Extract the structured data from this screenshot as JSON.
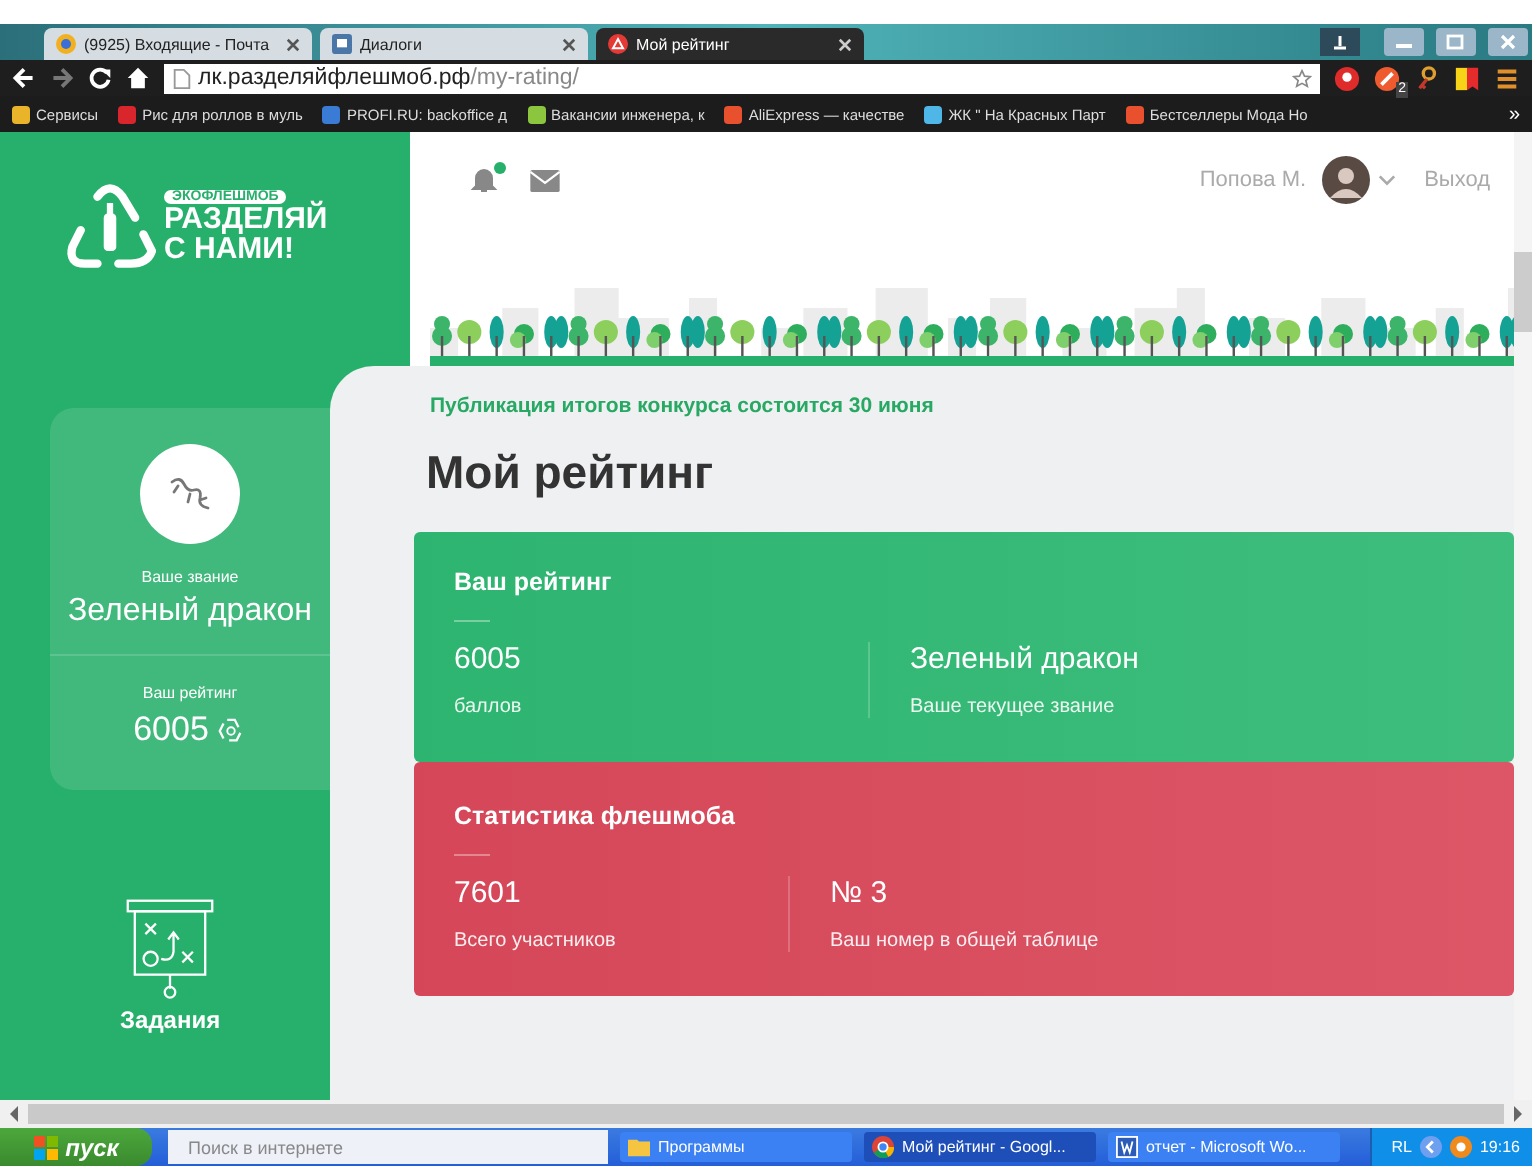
{
  "browser": {
    "tabs": [
      {
        "title": "(9925) Входящие - Почта",
        "kind": "mail",
        "selected": false
      },
      {
        "title": "Диалоги",
        "kind": "chat",
        "selected": false
      },
      {
        "title": "Мой рейтинг",
        "kind": "warn",
        "selected": true
      }
    ],
    "url": {
      "host": "лк.разделяйфлешмоб.рф",
      "path": "/my-rating/"
    },
    "extension_badge": "2",
    "bookmarks": [
      {
        "label": "Сервисы",
        "color": "#e9b42a"
      },
      {
        "label": "Рис для роллов в муль",
        "color": "#d8262c"
      },
      {
        "label": "PROFI.RU: backoffice д",
        "color": "#3a7bd5"
      },
      {
        "label": "Вакансии инженера, к",
        "color": "#8cc63f"
      },
      {
        "label": "AliExpress — качестве",
        "color": "#e8502e"
      },
      {
        "label": "ЖК \" На Красных Парт",
        "color": "#4fb6e8"
      },
      {
        "label": "Бестселлеры Мода Но",
        "color": "#e8502e"
      }
    ],
    "bookmarks_more": "»"
  },
  "sidebar": {
    "logo": {
      "tag": "ЭКОФЛЕШМОБ",
      "line1": "РАЗДЕЛЯЙ",
      "line2": "С НАМИ!"
    },
    "rank_label": "Ваше звание",
    "rank": "Зеленый дракон",
    "rating_label": "Ваш рейтинг",
    "rating": "6005",
    "nav": [
      {
        "label": "Задания"
      }
    ]
  },
  "header": {
    "notifications_unread": true,
    "user": "Попова М.",
    "logout": "Выход"
  },
  "notice": "Публикация итогов конкурса состоится 30 июня",
  "title": "Мой рейтинг",
  "cards": [
    {
      "kind": "rating",
      "color": "#2eb872",
      "title": "Ваш рейтинг",
      "stats": [
        {
          "value": "6005",
          "label": "баллов"
        },
        {
          "value": "Зеленый дракон",
          "label": "Ваше текущее звание"
        }
      ]
    },
    {
      "kind": "stats",
      "color": "#d9485a",
      "title": "Статистика флешмоба",
      "stats": [
        {
          "value": "7601",
          "label": "Всего участников"
        },
        {
          "value": "№ 3",
          "label": "Ваш номер в общей таблице"
        }
      ]
    }
  ],
  "taskbar": {
    "start": "пуск",
    "search_placeholder": "Поиск в интернете",
    "tasks": [
      {
        "label": "Программы",
        "kind": "folder",
        "selected": false
      },
      {
        "label": "Мой рейтинг - Googl...",
        "kind": "chrome",
        "selected": true
      },
      {
        "label": "отчет - Microsoft Wo...",
        "kind": "word",
        "selected": false
      }
    ],
    "lang": "RL",
    "time": "19:16"
  }
}
